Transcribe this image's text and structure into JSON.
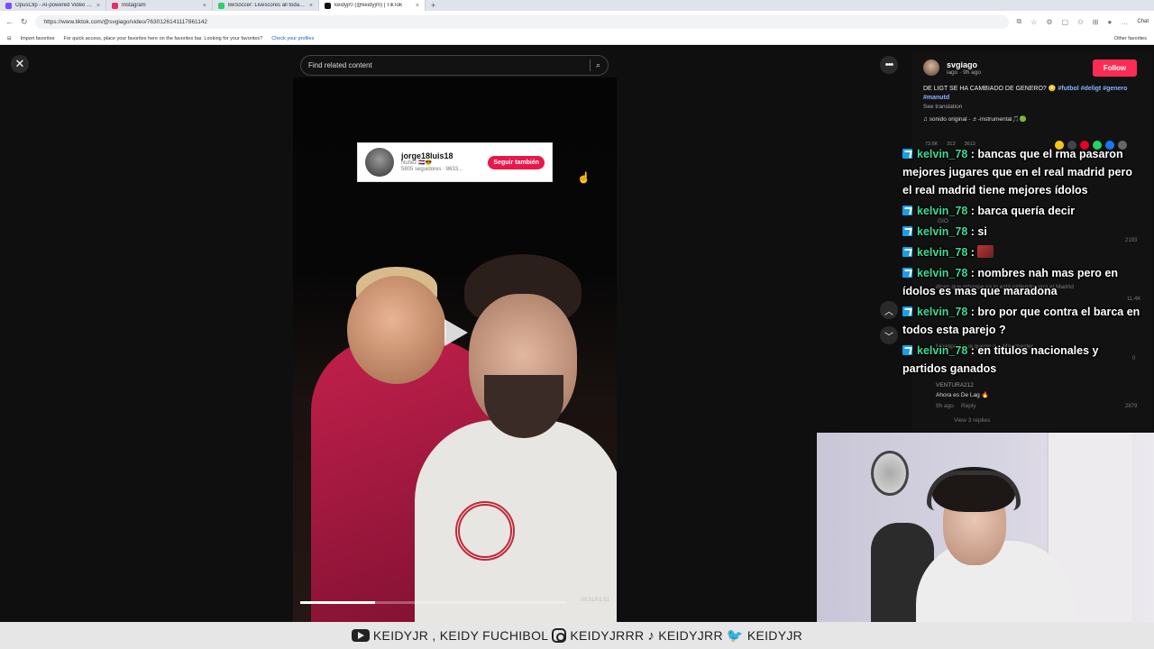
{
  "browser": {
    "tabs": [
      {
        "title": "OpusClip - AI-powered Video Re...",
        "color": "#7a4cff",
        "active": false
      },
      {
        "title": "Instagram",
        "color": "#e1306c",
        "active": false
      },
      {
        "title": "BeSoccer: Livescores all today's live...",
        "color": "#2ecc71",
        "active": false
      },
      {
        "title": "keidyjr0 (@keidyjr0) | TikTok",
        "color": "#111111",
        "active": true
      }
    ],
    "url": "https://www.tiktok.com/@svgiago/video/7630126141117861142",
    "chat_label": "Chat",
    "favbar": {
      "import": "Import favorites",
      "hint": "For quick access, place your favorites here on the favorites bar. Looking for your favorites?",
      "link": "Check your profiles",
      "other": "Other favorites"
    }
  },
  "search": {
    "placeholder": "Find related content"
  },
  "watermark_card": {
    "name": "jorge18luis18",
    "sub1": "Nuñez 🇳🇱😎",
    "sub2": "5805 seguidores · 8633...",
    "button": "Seguir también"
  },
  "video": {
    "progress": 0.28,
    "timecode": "00:31/01:51"
  },
  "author": {
    "name": "svgiago",
    "meta": "iago · 9h ago",
    "follow": "Follow"
  },
  "description": {
    "text": "DE LIGT SE HA CAMBIADO DE GENERO? 😳",
    "tags": "#futbol #deligt #genero #manutd",
    "see_translation": "See translation",
    "music": "♫  sonido original - ♬-instrumental🎵🟢"
  },
  "stats": {
    "likes": "73.6K",
    "comments": "313",
    "saves": "3613"
  },
  "faint_comments": [
    {
      "text": "GIO",
      "like": "2193"
    },
    {
      "text": "dicen que mbappe ya lo está pidiendo para el Madrid",
      "like": "11.4K"
    },
    {
      "text": "Mbappe se va querer ir a Manchester",
      "like": "0"
    },
    {
      "author": "VENTURA212",
      "text": "Ahora es De Lag 🔥",
      "time": "9h ago",
      "reply": "Reply",
      "like": "2879",
      "view_replies": "View 3 replies"
    }
  ],
  "chat": [
    {
      "user": "kelvin_78",
      "text": " : bancas que el rma pasaron mejores jugares que en el real madrid pero el real madrid tiene mejores ídolos"
    },
    {
      "user": "kelvin_78",
      "text": " : barca quería decir"
    },
    {
      "user": "kelvin_78",
      "text": " : si"
    },
    {
      "user": "kelvin_78",
      "text": " : "
    },
    {
      "user": "kelvin_78",
      "text": " : nombres nah mas pero en ídolos es mas que maradona"
    },
    {
      "user": "kelvin_78",
      "text": " : bro por que contra el barca en todos esta parejo ?"
    },
    {
      "user": "kelvin_78",
      "text": " : en titulos nacionales y partidos ganados"
    }
  ],
  "bottom_bar": {
    "youtube": "KEIDYJR , KEIDY FUCHIBOL",
    "instagram": "KEIDYJRRR",
    "tiktok": "KEIDYJRR",
    "twitter": "KEIDYJR"
  }
}
